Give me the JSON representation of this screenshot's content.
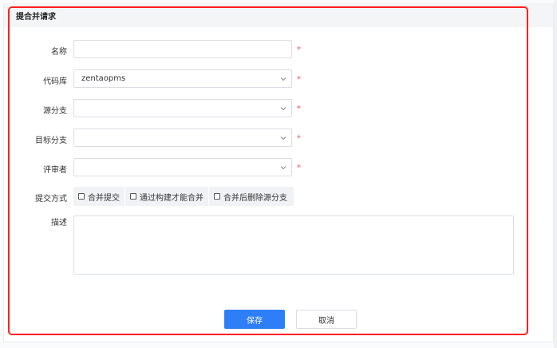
{
  "form": {
    "title": "提合并请求",
    "required_mark": "*",
    "fields": {
      "name": {
        "label": "名称",
        "value": ""
      },
      "repo": {
        "label": "代码库",
        "value": "zentaopms"
      },
      "source_branch": {
        "label": "源分支",
        "value": ""
      },
      "target_branch": {
        "label": "目标分支",
        "value": ""
      },
      "reviewer": {
        "label": "评审者",
        "value": ""
      },
      "submit_method": {
        "label": "提交方式",
        "options": [
          "合并提交",
          "通过构建才能合并",
          "合并后删除源分支"
        ]
      },
      "description": {
        "label": "描述",
        "value": ""
      }
    },
    "save_label": "保存",
    "cancel_label": "取消"
  },
  "colors": {
    "primary": "#2e7ff7",
    "required": "#ff4d4f",
    "highlight": "#ff1f1f"
  },
  "icons": {
    "select_arrow": "chevron-down-icon",
    "checkbox": "checkbox-unchecked-icon"
  }
}
